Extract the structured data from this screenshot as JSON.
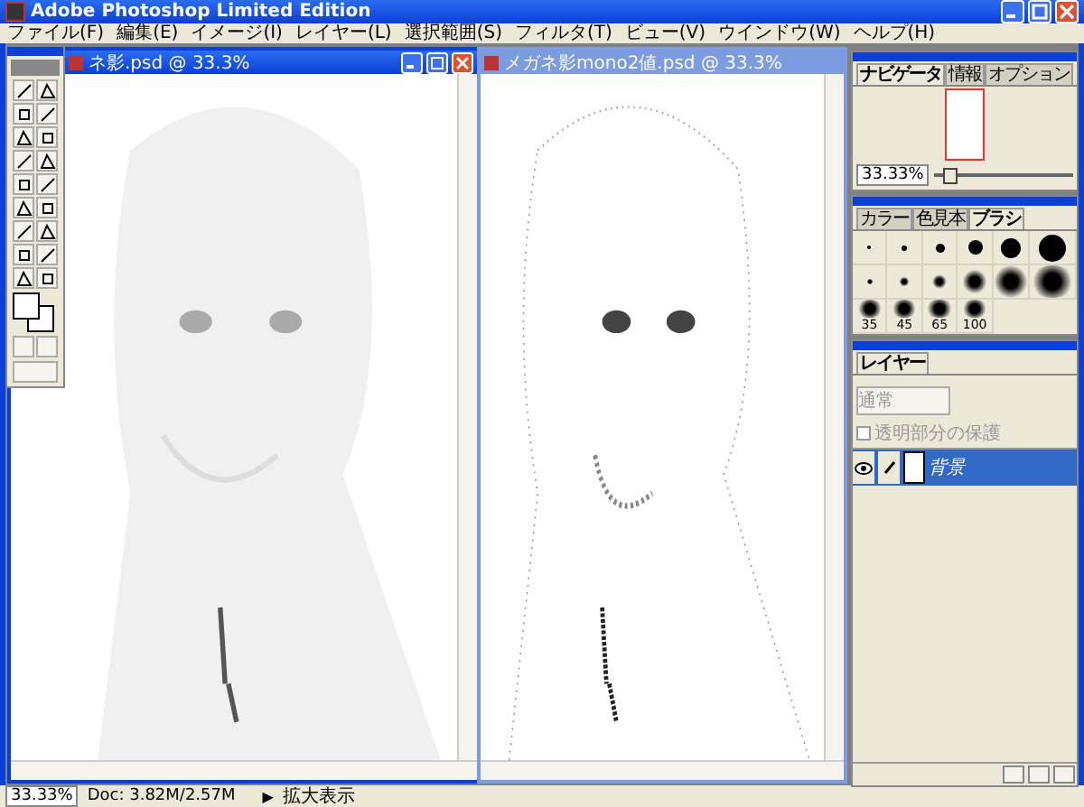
{
  "window": {
    "title": "Adobe Photoshop Limited Edition"
  },
  "menu": [
    "ファイル(F)",
    "編集(E)",
    "イメージ(I)",
    "レイヤー(L)",
    "選択範囲(S)",
    "フィルタ(T)",
    "ビュー(V)",
    "ウインドウ(W)",
    "ヘルプ(H)"
  ],
  "documents": [
    {
      "title": "ネ影.psd @ 33.3%",
      "active": true,
      "kind": "soft"
    },
    {
      "title": "メガネ影mono2値.psd @ 33.3%",
      "active": false,
      "kind": "dotted"
    }
  ],
  "navigator": {
    "tabs": [
      {
        "label": "ナビゲータ",
        "selected": true
      },
      {
        "label": "情報",
        "selected": false
      },
      {
        "label": "オプション",
        "selected": false
      }
    ],
    "zoom": "33.33%",
    "slider": {
      "level": 0.1
    }
  },
  "swatches": {
    "tabs": [
      {
        "label": "カラー",
        "selected": false
      },
      {
        "label": "色見本",
        "selected": false
      },
      {
        "label": "ブラシ",
        "selected": true
      }
    ],
    "brushes": [
      {
        "kind": "hard"
      },
      {
        "kind": "hard"
      },
      {
        "kind": "hard"
      },
      {
        "kind": "hard"
      },
      {
        "kind": "hard"
      },
      {
        "kind": "hard"
      },
      {
        "kind": "soft"
      },
      {
        "kind": "soft"
      },
      {
        "kind": "soft"
      },
      {
        "kind": "soft"
      },
      {
        "kind": "soft"
      },
      {
        "kind": "soft"
      },
      {
        "kind": "soft",
        "label": "35"
      },
      {
        "kind": "soft",
        "label": "45"
      },
      {
        "kind": "soft",
        "label": "65"
      },
      {
        "kind": "soft",
        "label": "100"
      }
    ]
  },
  "layers": {
    "tabs": [
      {
        "label": "レイヤー",
        "selected": true
      }
    ],
    "blend_mode": "通常",
    "preserve_transparency": {
      "label": "透明部分の保護",
      "checked": false,
      "disabled": true
    },
    "items": [
      {
        "name": "背景",
        "selected": true,
        "visible": true
      }
    ]
  },
  "status_bar": {
    "zoom": "33.33%",
    "doc": "Doc: 3.82M/2.57M",
    "arrow": "▶",
    "tool": "拡大表示"
  }
}
